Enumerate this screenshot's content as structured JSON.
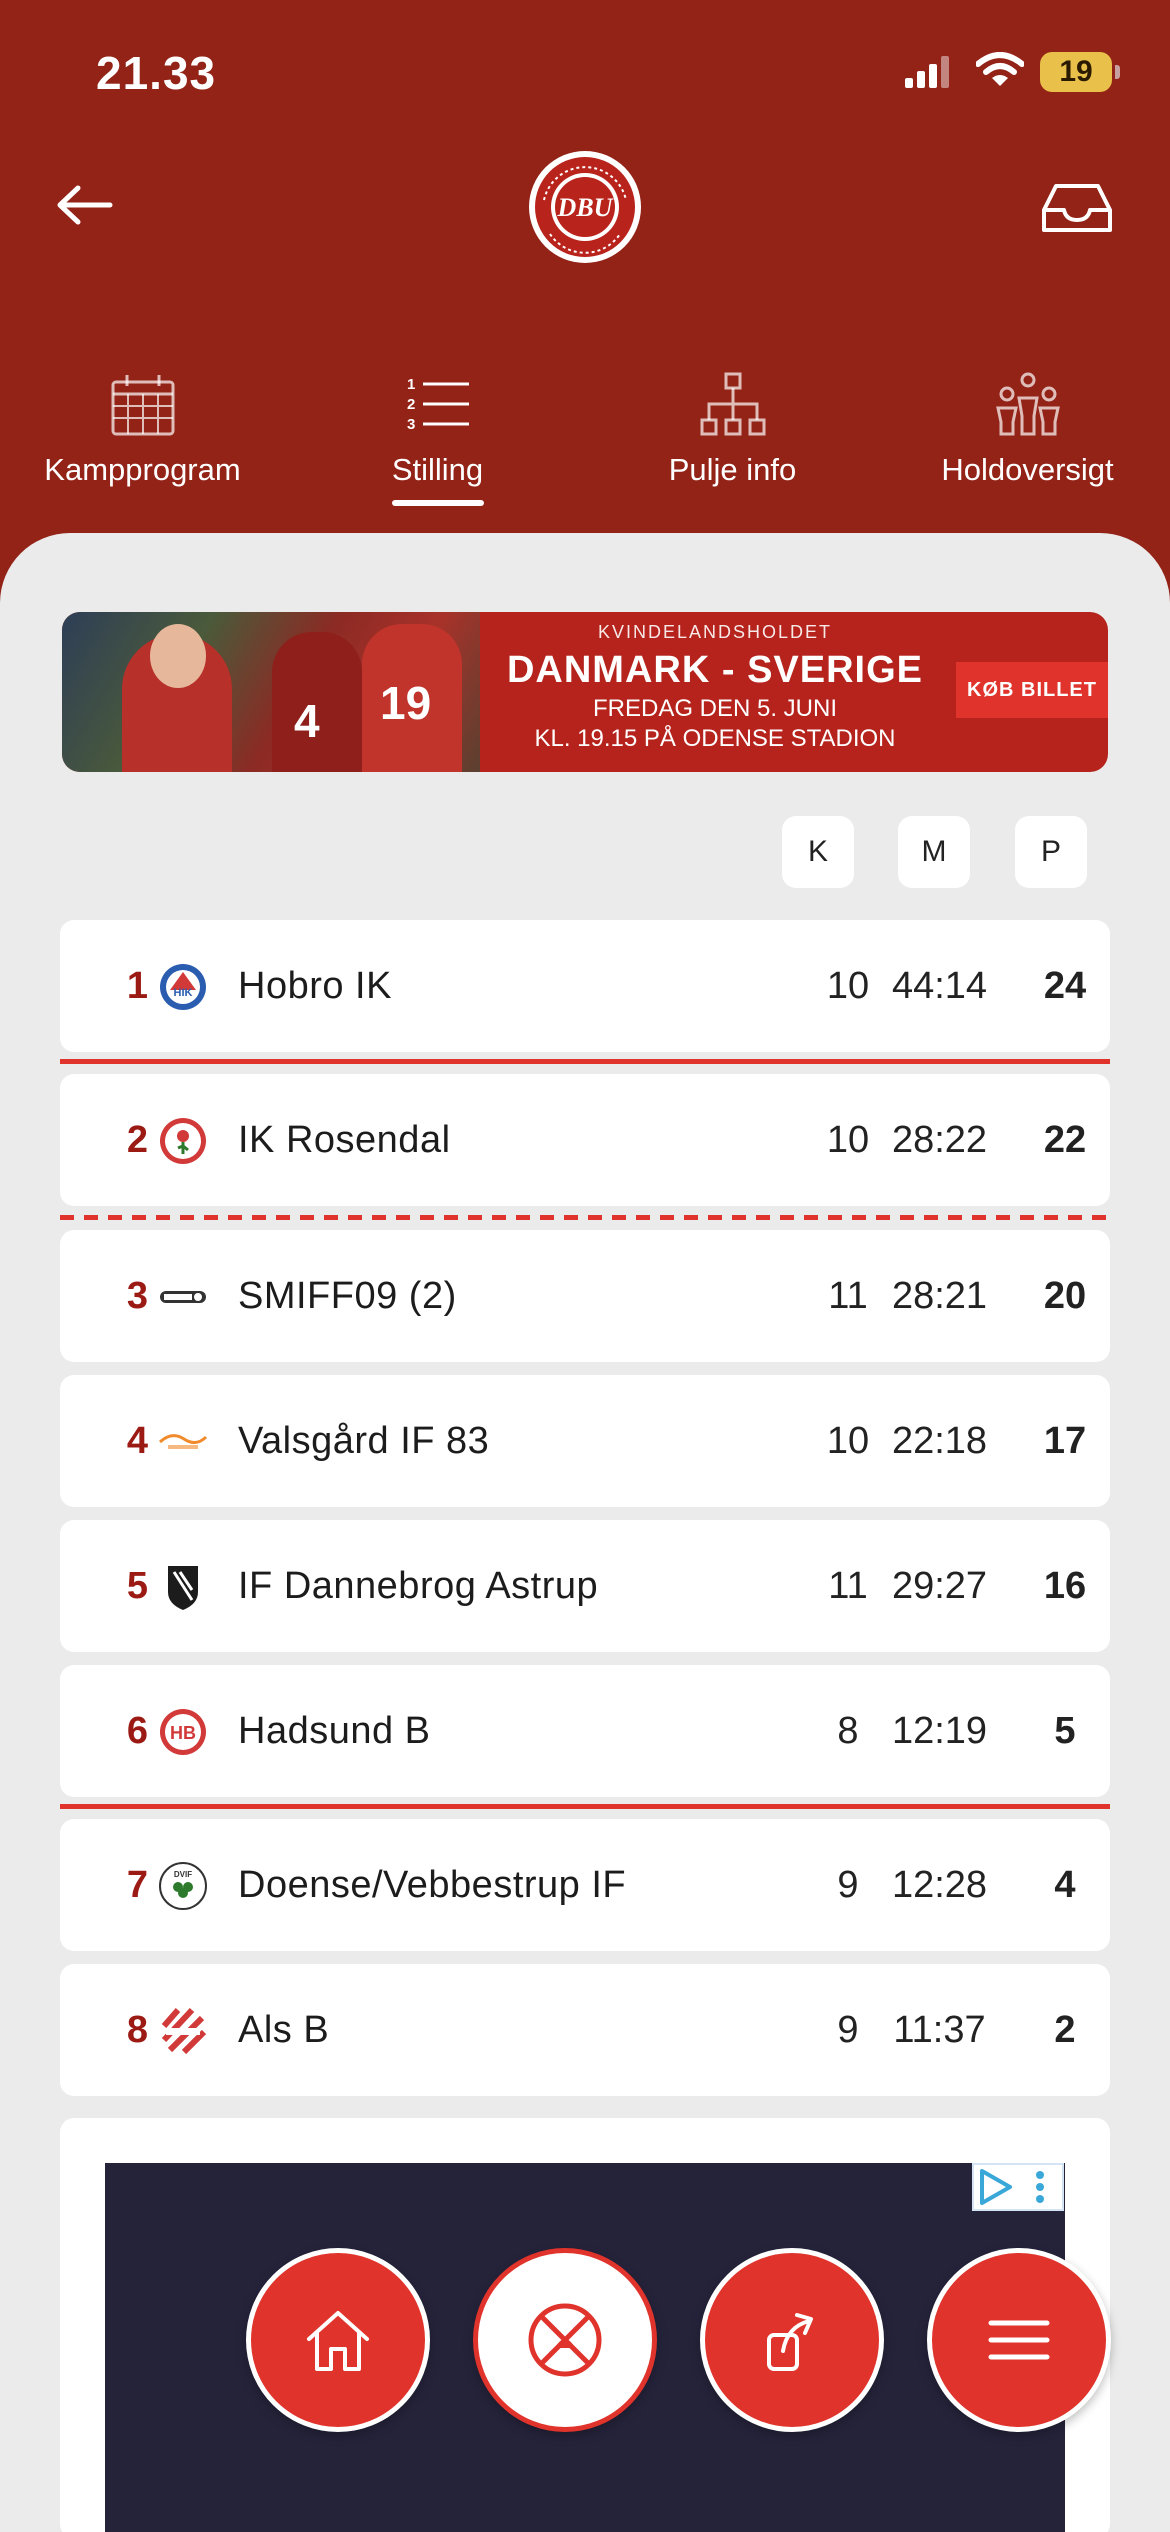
{
  "status_bar": {
    "time": "21.33",
    "battery": "19"
  },
  "nav": [
    {
      "label": "Kampprogram",
      "icon": "calendar-icon",
      "active": false
    },
    {
      "label": "Stilling",
      "icon": "numbered-list-icon",
      "active": true
    },
    {
      "label": "Pulje info",
      "icon": "hierarchy-icon",
      "active": false
    },
    {
      "label": "Holdoversigt",
      "icon": "team-icon",
      "active": false
    }
  ],
  "banner": {
    "eyebrow": "KVINDELANDSHOLDET",
    "headline": "DANMARK - SVERIGE",
    "line1": "FREDAG DEN 5. JUNI",
    "line2": "KL. 19.15 PÅ ODENSE STADION",
    "cta": "KØB BILLET",
    "jersey_numbers": [
      "4",
      "19"
    ]
  },
  "columns": {
    "k": "K",
    "m": "M",
    "p": "P"
  },
  "standings": [
    {
      "pos": "1",
      "team": "Hobro IK",
      "k": "10",
      "m": "44:14",
      "p": "24"
    },
    {
      "pos": "2",
      "team": "IK Rosendal",
      "k": "10",
      "m": "28:22",
      "p": "22"
    },
    {
      "pos": "3",
      "team": "SMIFF09 (2)",
      "k": "11",
      "m": "28:21",
      "p": "20"
    },
    {
      "pos": "4",
      "team": "Valsgård IF 83",
      "k": "10",
      "m": "22:18",
      "p": "17"
    },
    {
      "pos": "5",
      "team": "IF Dannebrog Astrup",
      "k": "11",
      "m": "29:27",
      "p": "16"
    },
    {
      "pos": "6",
      "team": "Hadsund B",
      "k": "8",
      "m": "12:19",
      "p": "5"
    },
    {
      "pos": "7",
      "team": "Doense/Vebbestrup IF",
      "k": "9",
      "m": "12:28",
      "p": "4"
    },
    {
      "pos": "8",
      "team": "Als B",
      "k": "9",
      "m": "11:37",
      "p": "2"
    }
  ],
  "fab": [
    {
      "icon": "home-icon"
    },
    {
      "icon": "dbu-ball-icon"
    },
    {
      "icon": "share-icon"
    },
    {
      "icon": "menu-icon"
    }
  ],
  "colors": {
    "header": "#932217",
    "accent": "#e0332b",
    "position": "#9b1b14"
  }
}
